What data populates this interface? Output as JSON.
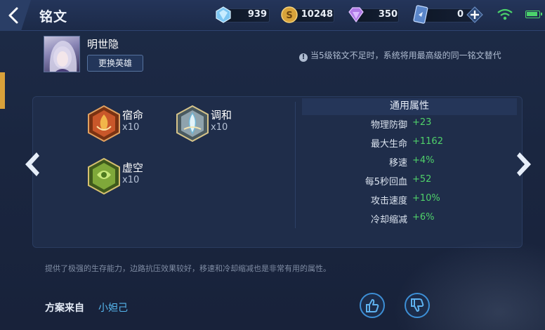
{
  "header": {
    "title": "铭文",
    "resources": [
      {
        "icon": "diamond-icon",
        "value": "939"
      },
      {
        "icon": "gold-coin-icon",
        "value": "10248"
      },
      {
        "icon": "crystal-icon",
        "value": "350"
      },
      {
        "icon": "card-ticket-icon",
        "value": "0"
      }
    ]
  },
  "hero": {
    "name": "明世隐",
    "change_button": "更换英雄"
  },
  "notice": "当5级铭文不足时，系统将用最高级的同一铭文替代",
  "inscriptions": [
    {
      "name": "宿命",
      "count": "x10",
      "color": "#c9572a"
    },
    {
      "name": "调和",
      "count": "x10",
      "color": "#9bb7c9"
    },
    {
      "name": "虚空",
      "count": "x10",
      "color": "#7fa83a"
    }
  ],
  "attributes": {
    "title": "通用属性",
    "rows": [
      {
        "label": "物理防御",
        "value": "+23"
      },
      {
        "label": "最大生命",
        "value": "+1162"
      },
      {
        "label": "移速",
        "value": "+4%"
      },
      {
        "label": "每5秒回血",
        "value": "+52"
      },
      {
        "label": "攻击速度",
        "value": "+10%"
      },
      {
        "label": "冷却缩减",
        "value": "+6%"
      }
    ]
  },
  "description": "提供了极强的生存能力，边路抗压效果较好，移速和冷却缩减也是非常有用的属性。",
  "source": {
    "label": "方案来自",
    "author": "小妲己"
  },
  "colors": {
    "accent_gold": "#d9a13a",
    "value_green": "#4fd16a",
    "link_blue": "#56b8f0"
  }
}
